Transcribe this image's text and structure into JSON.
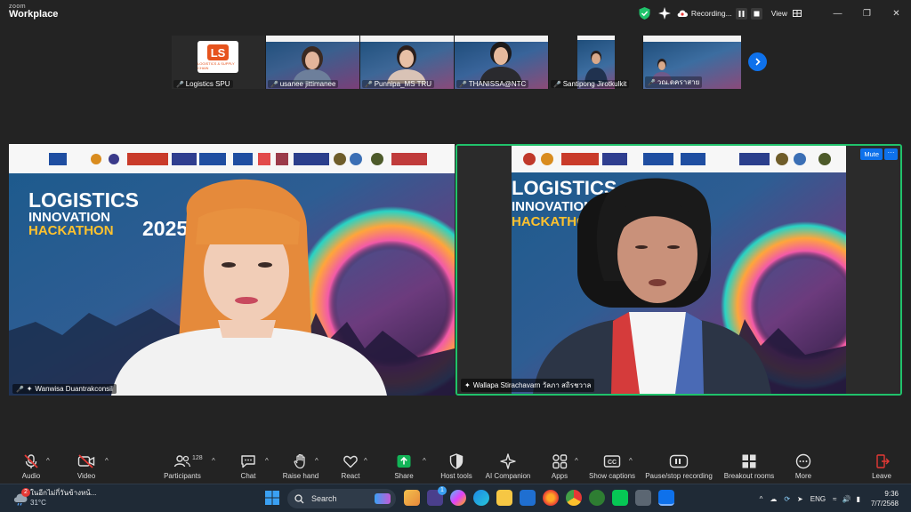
{
  "app": {
    "brand_top": "zoom",
    "brand_bottom": "Workplace"
  },
  "titlebar": {
    "recording_label": "Recording...",
    "view_label": "View"
  },
  "gallery": {
    "tiles": [
      {
        "name": "Logistics SPU",
        "logo_text": "LOGISTICS & SUPPLY CHAIN"
      },
      {
        "name": "usanee jittimanee"
      },
      {
        "name": "Punnipa_MS TRU"
      },
      {
        "name": "THANISSA@NTC"
      },
      {
        "name": "Santipong Jirotkulkit"
      },
      {
        "name": "วณ.ดคราสาย"
      }
    ]
  },
  "main": {
    "left": {
      "name": "Wanwisa Duantrakconsil"
    },
    "right": {
      "name": "Wallapa Stirachavarn วัลภา สถิรชวาล",
      "mute_label": "Mute",
      "more_label": "···"
    },
    "banner": {
      "line1": "LOGISTICS",
      "line2": "INNOVATION",
      "line3": "HACKATHON",
      "year": "2025"
    }
  },
  "toolbar": {
    "items": [
      {
        "label": "Audio",
        "icon": "mic-off-icon"
      },
      {
        "label": "Video",
        "icon": "video-off-icon"
      },
      {
        "label": "Participants",
        "icon": "participants-icon",
        "count": "128"
      },
      {
        "label": "Chat",
        "icon": "chat-icon"
      },
      {
        "label": "Raise hand",
        "icon": "hand-icon"
      },
      {
        "label": "React",
        "icon": "heart-icon"
      },
      {
        "label": "Share",
        "icon": "share-icon"
      },
      {
        "label": "Host tools",
        "icon": "shield-icon"
      },
      {
        "label": "AI Companion",
        "icon": "sparkle-icon"
      },
      {
        "label": "Apps",
        "icon": "apps-icon"
      },
      {
        "label": "Show captions",
        "icon": "cc-icon"
      },
      {
        "label": "Pause/stop recording",
        "icon": "pause-icon"
      },
      {
        "label": "Breakout rooms",
        "icon": "breakout-icon"
      },
      {
        "label": "More",
        "icon": "more-icon"
      },
      {
        "label": "Leave",
        "icon": "leave-icon"
      }
    ]
  },
  "taskbar": {
    "weather_text": "ในอีกไม่กี่วันข้างหน้...",
    "weather_temp": "31°C",
    "weather_badge": "2",
    "search_label": "Search",
    "teams_badge": "1",
    "lang": "ENG",
    "time": "9:36",
    "date": "7/7/2568"
  },
  "colors": {
    "accent_blue": "#0e71eb",
    "active_speaker": "#20c26b",
    "mute_red": "#e53935",
    "share_green": "#12b457"
  }
}
